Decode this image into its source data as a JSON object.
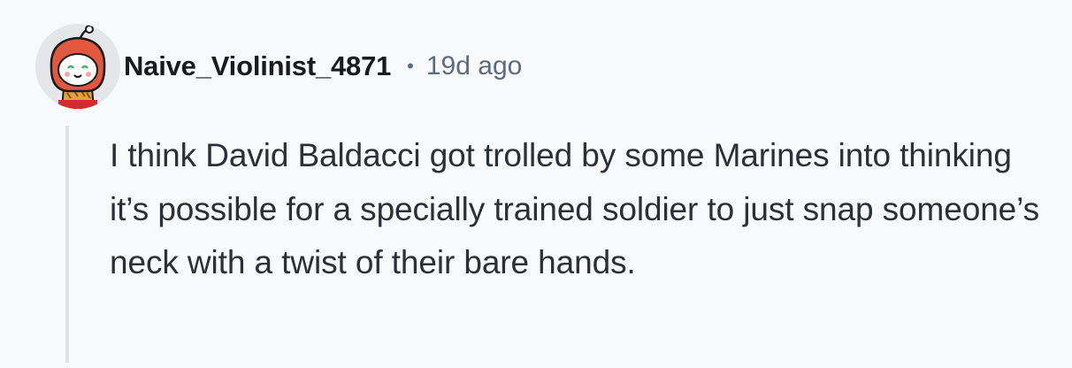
{
  "comment": {
    "username": "Naive_Violinist_4871",
    "separator": "•",
    "timestamp": "19d ago",
    "avatar_icon": "snoo-avatar-icon",
    "body": "I think David Baldacci got trolled by some Marines into thinking it’s possible for a specially trained soldier to just snap someone’s neck with a twist of their bare hands."
  },
  "colors": {
    "background": "#f8f9fb",
    "username": "#1a1a1b",
    "meta": "#5c6c7e",
    "body_text": "#2a3036",
    "thread_line": "#dfe3e8",
    "avatar_hood": "#e2583e"
  }
}
